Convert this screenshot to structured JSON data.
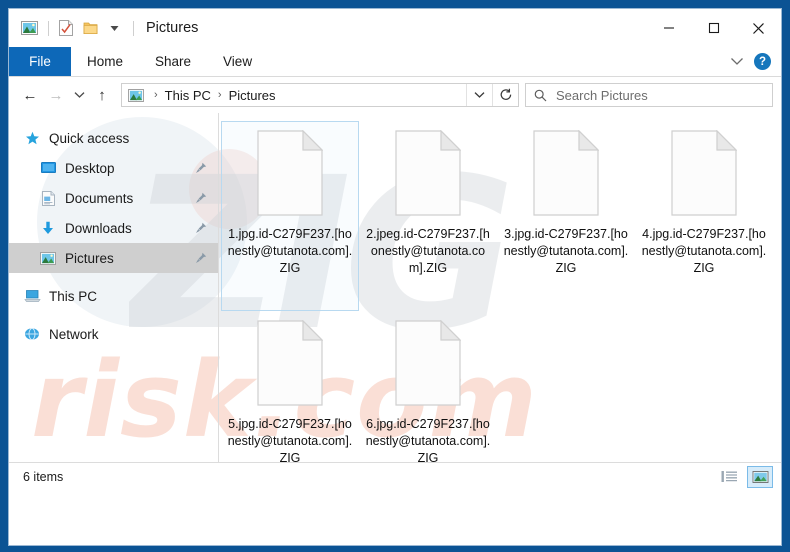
{
  "window": {
    "title": "Pictures",
    "frame_color": "#0b5394",
    "quick_access_toolbar": [
      {
        "name": "pictures-folder-icon",
        "icon": "picture"
      },
      {
        "name": "properties-icon",
        "icon": "doc-check"
      },
      {
        "name": "new-folder-icon",
        "icon": "folder"
      },
      {
        "name": "customize-qat-icon",
        "icon": "chevron-down"
      }
    ],
    "controls": {
      "minimize": "–",
      "maximize": "☐",
      "close": "✕"
    }
  },
  "ribbon": {
    "tabs": [
      {
        "label": "File",
        "active": true
      },
      {
        "label": "Home",
        "active": false
      },
      {
        "label": "Share",
        "active": false
      },
      {
        "label": "View",
        "active": false
      }
    ],
    "expand_icon": "chevron-down",
    "help_label": "?"
  },
  "navbar": {
    "back_icon": "←",
    "forward_icon": "→",
    "recent_icon": "⌄",
    "up_icon": "↑",
    "breadcrumb": [
      {
        "label": "This PC"
      },
      {
        "label": "Pictures"
      }
    ],
    "breadcrumb_separator": "›",
    "address_dropdown_icon": "⌄",
    "refresh_icon": "↻"
  },
  "search": {
    "placeholder": "Search Pictures",
    "value": "",
    "icon": "search-icon"
  },
  "sidebar": {
    "items": [
      {
        "label": "Quick access",
        "icon": "star",
        "indent": false,
        "selected": false,
        "pinned": false
      },
      {
        "label": "Desktop",
        "icon": "desktop",
        "indent": true,
        "selected": false,
        "pinned": true
      },
      {
        "label": "Documents",
        "icon": "documents",
        "indent": true,
        "selected": false,
        "pinned": true
      },
      {
        "label": "Downloads",
        "icon": "downloads",
        "indent": true,
        "selected": false,
        "pinned": true
      },
      {
        "label": "Pictures",
        "icon": "pictures",
        "indent": true,
        "selected": true,
        "pinned": true
      },
      {
        "label": "This PC",
        "icon": "thispc",
        "indent": false,
        "selected": false,
        "pinned": false
      },
      {
        "label": "Network",
        "icon": "network",
        "indent": false,
        "selected": false,
        "pinned": false
      }
    ]
  },
  "files": [
    {
      "name": "1.jpg.id-C279F237.[honestly@tutanota.com].ZIG",
      "icon": "generic-file",
      "selected": true
    },
    {
      "name": "2.jpeg.id-C279F237.[honestly@tutanota.com].ZIG",
      "icon": "generic-file",
      "selected": false
    },
    {
      "name": "3.jpg.id-C279F237.[honestly@tutanota.com].ZIG",
      "icon": "generic-file",
      "selected": false
    },
    {
      "name": "4.jpg.id-C279F237.[honestly@tutanota.com].ZIG",
      "icon": "generic-file",
      "selected": false
    },
    {
      "name": "5.jpg.id-C279F237.[honestly@tutanota.com].ZIG",
      "icon": "generic-file",
      "selected": false
    },
    {
      "name": "6.jpg.id-C279F237.[honestly@tutanota.com].ZIG",
      "icon": "generic-file",
      "selected": false
    }
  ],
  "status": {
    "item_count": "6 items",
    "views": [
      {
        "name": "details-view",
        "active": false
      },
      {
        "name": "large-icons-view",
        "active": true
      }
    ]
  },
  "watermarks": {
    "gray_text": "ZIG",
    "brand_text": "risk.com"
  }
}
